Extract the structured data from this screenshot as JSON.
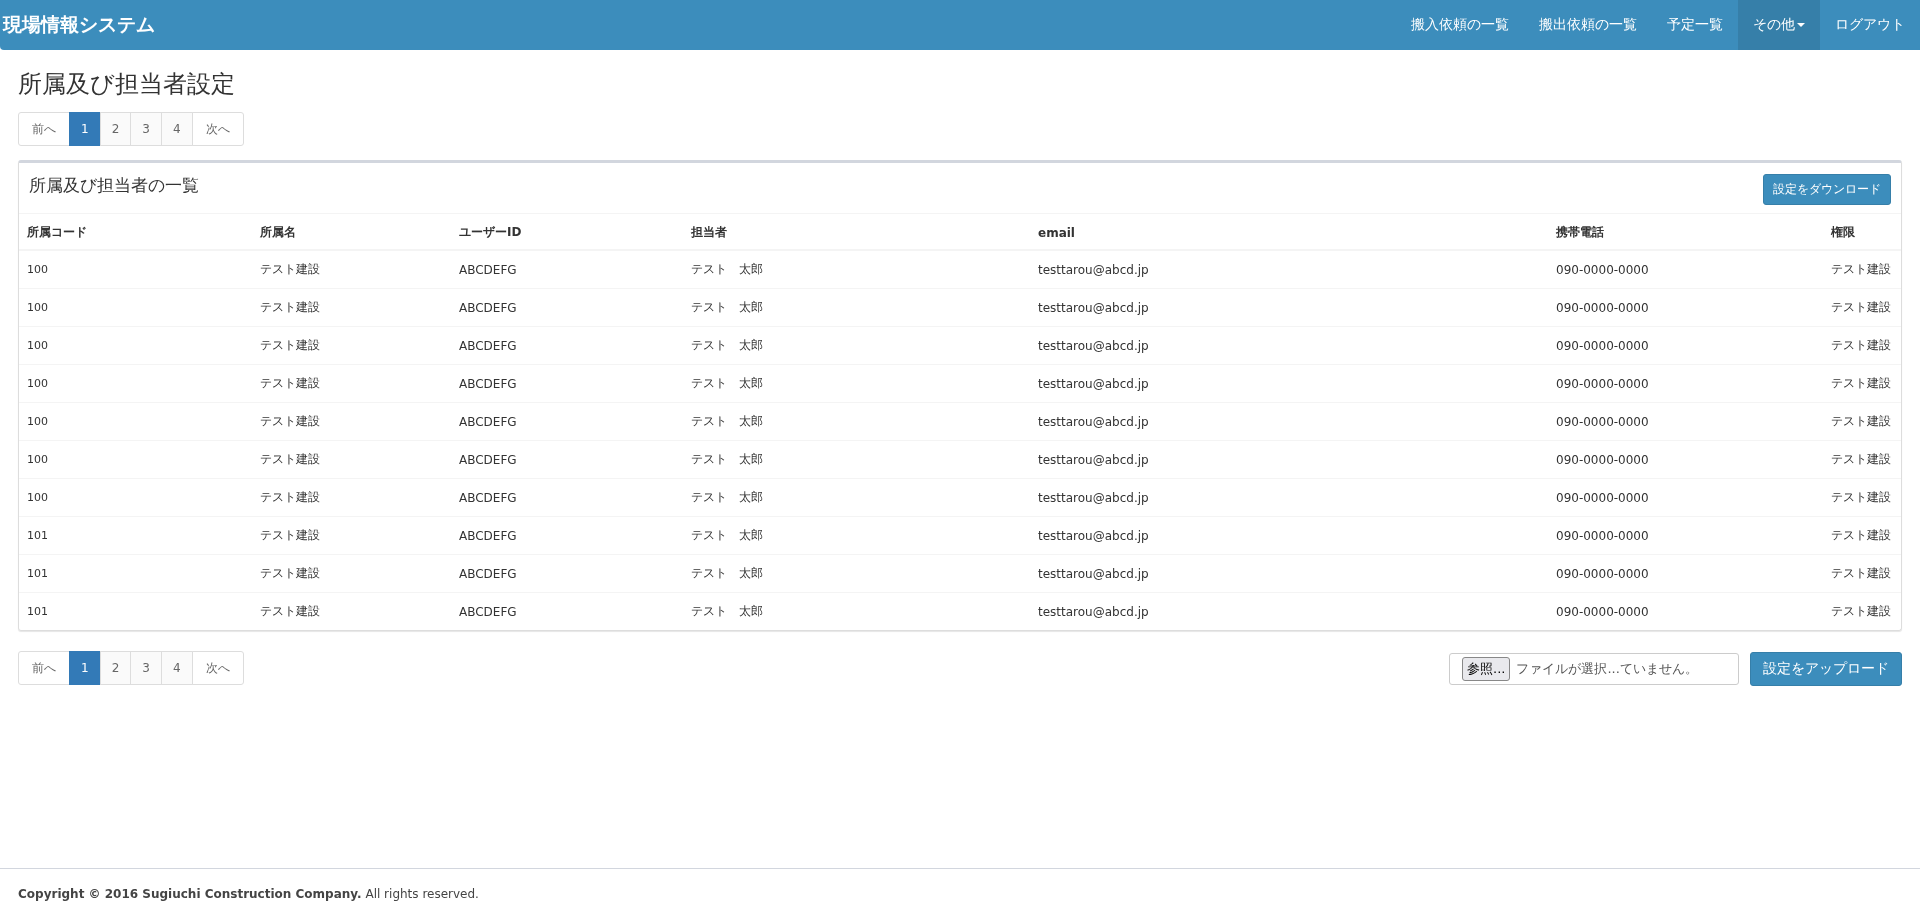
{
  "navbar": {
    "brand": "現場情報システム",
    "items": [
      {
        "label": "搬入依頼の一覧",
        "selected": false,
        "dropdown": false
      },
      {
        "label": "搬出依頼の一覧",
        "selected": false,
        "dropdown": false
      },
      {
        "label": "予定一覧",
        "selected": false,
        "dropdown": false
      },
      {
        "label": "その他",
        "selected": true,
        "dropdown": true
      },
      {
        "label": "ログアウト",
        "selected": false,
        "dropdown": false
      }
    ]
  },
  "page_title": "所属及び担当者設定",
  "pagination_top": {
    "prev": "前へ",
    "next": "次へ",
    "pages": [
      {
        "label": "1",
        "selected": true
      },
      {
        "label": "2",
        "selected": false
      },
      {
        "label": "3",
        "selected": false
      },
      {
        "label": "4",
        "selected": false
      }
    ]
  },
  "panel": {
    "title": "所属及び担当者の一覧",
    "download_button": "設定をダウンロード",
    "table": {
      "columns": [
        "所属コード",
        "所属名",
        "ユーザーID",
        "担当者",
        "email",
        "携帯電話",
        "権限"
      ],
      "rows": [
        [
          "100",
          "テスト建設",
          "ABCDEFG",
          "テスト　太郎",
          "testtarou@abcd.jp",
          "090-0000-0000",
          "テスト建設"
        ],
        [
          "100",
          "テスト建設",
          "ABCDEFG",
          "テスト　太郎",
          "testtarou@abcd.jp",
          "090-0000-0000",
          "テスト建設"
        ],
        [
          "100",
          "テスト建設",
          "ABCDEFG",
          "テスト　太郎",
          "testtarou@abcd.jp",
          "090-0000-0000",
          "テスト建設"
        ],
        [
          "100",
          "テスト建設",
          "ABCDEFG",
          "テスト　太郎",
          "testtarou@abcd.jp",
          "090-0000-0000",
          "テスト建設"
        ],
        [
          "100",
          "テスト建設",
          "ABCDEFG",
          "テスト　太郎",
          "testtarou@abcd.jp",
          "090-0000-0000",
          "テスト建設"
        ],
        [
          "100",
          "テスト建設",
          "ABCDEFG",
          "テスト　太郎",
          "testtarou@abcd.jp",
          "090-0000-0000",
          "テスト建設"
        ],
        [
          "100",
          "テスト建設",
          "ABCDEFG",
          "テスト　太郎",
          "testtarou@abcd.jp",
          "090-0000-0000",
          "テスト建設"
        ],
        [
          "101",
          "テスト建設",
          "ABCDEFG",
          "テスト　太郎",
          "testtarou@abcd.jp",
          "090-0000-0000",
          "テスト建設"
        ],
        [
          "101",
          "テスト建設",
          "ABCDEFG",
          "テスト　太郎",
          "testtarou@abcd.jp",
          "090-0000-0000",
          "テスト建設"
        ],
        [
          "101",
          "テスト建設",
          "ABCDEFG",
          "テスト　太郎",
          "testtarou@abcd.jp",
          "090-0000-0000",
          "テスト建設"
        ]
      ]
    }
  },
  "pagination_bottom": {
    "prev": "前へ",
    "next": "次へ",
    "pages": [
      {
        "label": "1",
        "selected": true
      },
      {
        "label": "2",
        "selected": false
      },
      {
        "label": "3",
        "selected": false
      },
      {
        "label": "4",
        "selected": false
      }
    ]
  },
  "file_input": {
    "button": "参照...",
    "status": "ファイルが選択...ていません。"
  },
  "upload_button": "設定をアップロード",
  "footer": "**Copyright © 2016  Sugiuchi Construction Company.** All rights reserved."
}
